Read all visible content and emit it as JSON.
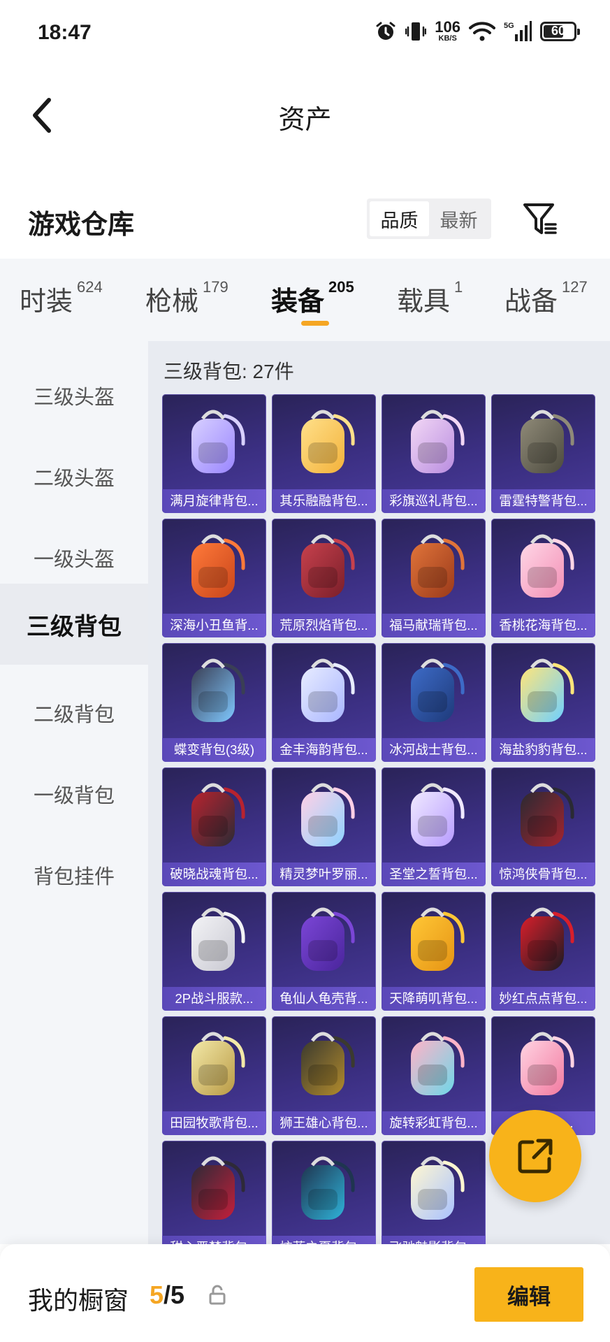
{
  "status_bar": {
    "time": "18:47",
    "net_speed_value": "106",
    "net_speed_unit": "KB/S",
    "network": "5G",
    "battery": "60",
    "icons": [
      "alarm-icon",
      "vibrate-icon",
      "wifi-icon",
      "signal-icon",
      "battery-icon"
    ]
  },
  "header": {
    "title": "资产",
    "back_icon": "chevron-left-icon"
  },
  "section": {
    "title": "游戏仓库",
    "sort_options": [
      "品质",
      "最新"
    ],
    "sort_selected": "品质",
    "filter_icon": "filter-icon"
  },
  "tabs": [
    {
      "label": "时装",
      "count": "624"
    },
    {
      "label": "枪械",
      "count": "179"
    },
    {
      "label": "装备",
      "count": "205",
      "active": true
    },
    {
      "label": "载具",
      "count": "1"
    },
    {
      "label": "战备",
      "count": "127"
    }
  ],
  "sidebar": {
    "items": [
      "三级头盔",
      "二级头盔",
      "一级头盔",
      "三级背包",
      "二级背包",
      "一级背包",
      "背包挂件"
    ],
    "active_index": 3
  },
  "content": {
    "heading": "三级背包: 27件",
    "items": [
      {
        "name": "满月旋律背包...",
        "icon": "backpack-icon"
      },
      {
        "name": "其乐融融背包...",
        "icon": "backpack-icon"
      },
      {
        "name": "彩旗巡礼背包...",
        "icon": "backpack-icon"
      },
      {
        "name": "雷霆特警背包...",
        "icon": "backpack-icon"
      },
      {
        "name": "深海小丑鱼背...",
        "icon": "backpack-icon"
      },
      {
        "name": "荒原烈焰背包...",
        "icon": "backpack-icon"
      },
      {
        "name": "福马献瑞背包...",
        "icon": "backpack-icon"
      },
      {
        "name": "香桃花海背包...",
        "icon": "backpack-icon"
      },
      {
        "name": "蝶变背包(3级)",
        "icon": "backpack-icon"
      },
      {
        "name": "金丰海韵背包...",
        "icon": "backpack-icon"
      },
      {
        "name": "冰河战士背包...",
        "icon": "backpack-icon"
      },
      {
        "name": "海盐豹豹背包...",
        "icon": "backpack-icon"
      },
      {
        "name": "破晓战魂背包...",
        "icon": "backpack-icon"
      },
      {
        "name": "精灵梦叶罗丽...",
        "icon": "backpack-icon"
      },
      {
        "name": "圣堂之誓背包...",
        "icon": "backpack-icon"
      },
      {
        "name": "惊鸿侠骨背包...",
        "icon": "backpack-icon"
      },
      {
        "name": "2P战斗服款...",
        "icon": "backpack-icon"
      },
      {
        "name": "龟仙人龟壳背...",
        "icon": "backpack-icon"
      },
      {
        "name": "天降萌叽背包...",
        "icon": "backpack-icon"
      },
      {
        "name": "妙红点点背包...",
        "icon": "backpack-icon"
      },
      {
        "name": "田园牧歌背包...",
        "icon": "backpack-icon"
      },
      {
        "name": "狮王雄心背包...",
        "icon": "backpack-icon"
      },
      {
        "name": "旋转彩虹背包...",
        "icon": "backpack-icon"
      },
      {
        "name": "嫣...背包...",
        "icon": "backpack-icon"
      },
      {
        "name": "甜心恶梦背包...",
        "icon": "backpack-icon"
      },
      {
        "name": "炫蓝之夏背包...",
        "icon": "backpack-icon"
      },
      {
        "name": "飞驰魅影背包...",
        "icon": "backpack-icon"
      }
    ]
  },
  "fab": {
    "icon": "share-external-icon"
  },
  "showcase": {
    "label": "我的橱窗",
    "used": "5",
    "separator": "/",
    "total": "5",
    "lock_icon": "lock-icon",
    "edit_label": "编辑"
  },
  "colors": {
    "accent": "#f8b31a",
    "card_bg": "#3b2f82",
    "card_label_bg": "#6d58cf",
    "panel_bg": "#e8ebf1",
    "sidebar_bg": "#f4f6f9"
  }
}
